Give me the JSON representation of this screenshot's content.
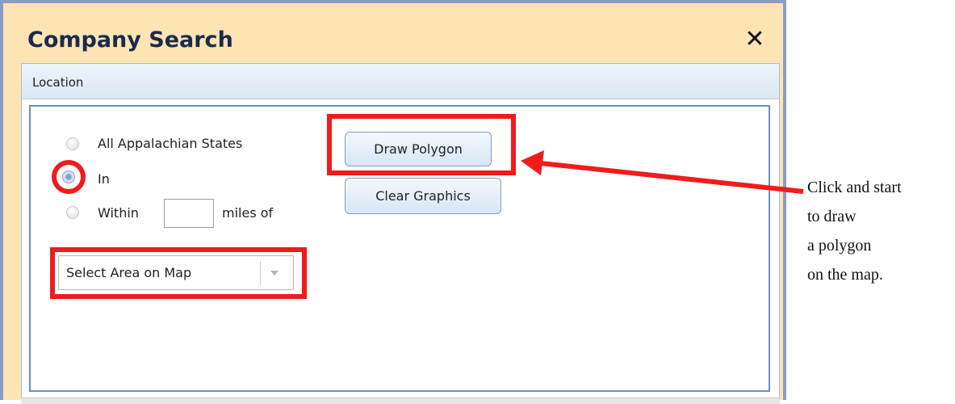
{
  "dialog": {
    "title": "Company Search",
    "close_icon": "close-icon"
  },
  "section": {
    "label": "Location"
  },
  "options": [
    {
      "label": "All Appalachian States",
      "checked": false
    },
    {
      "label": "In",
      "checked": true
    },
    {
      "label": "Within",
      "suffix": "miles of",
      "checked": false
    }
  ],
  "miles_input": {
    "value": ""
  },
  "area_select": {
    "selected": "Select Area on Map"
  },
  "buttons": {
    "draw_polygon": "Draw Polygon",
    "clear_graphics": "Clear Graphics"
  },
  "annotation": {
    "lines": [
      "Click and start",
      "to draw",
      "a polygon",
      "on the map."
    ]
  },
  "colors": {
    "highlight": "#ee1c1c",
    "dialog_bg": "#fde4b3",
    "frame": "#8a9bc6",
    "panel_border": "#6d8fbe"
  }
}
